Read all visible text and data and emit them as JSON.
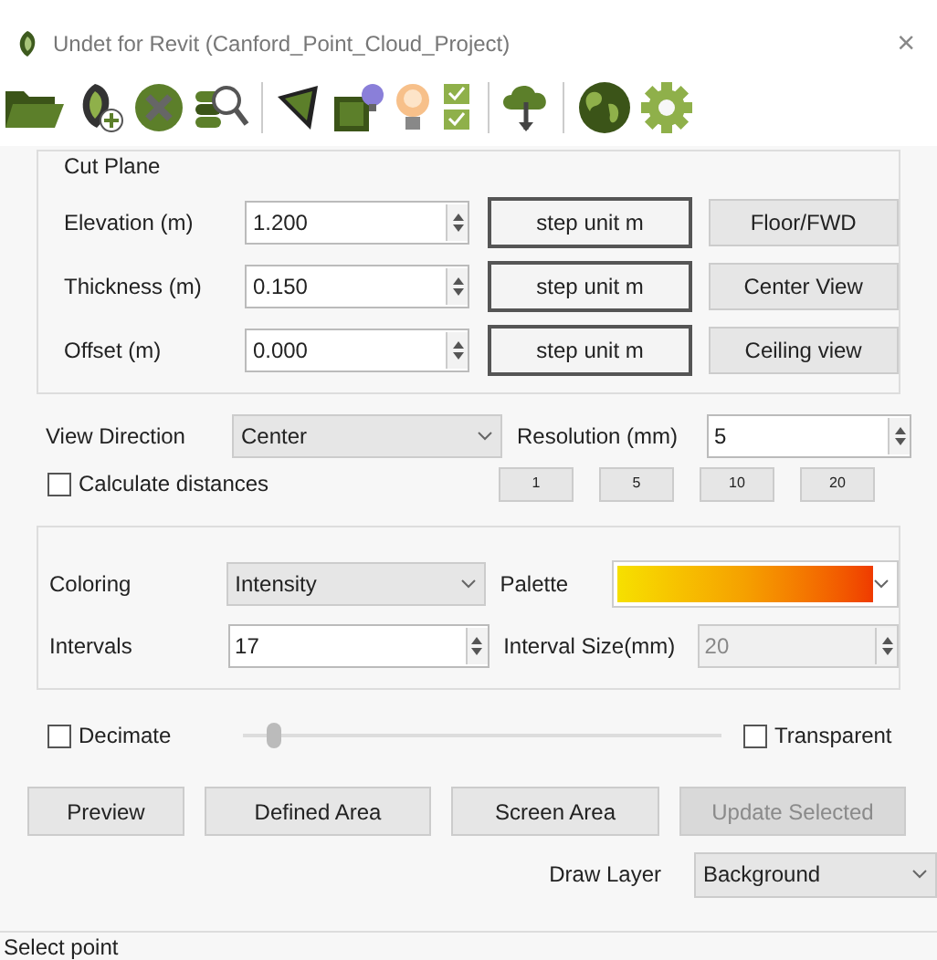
{
  "window": {
    "title": "Undet for Revit (Canford_Point_Cloud_Project)",
    "close": "×"
  },
  "cut_plane": {
    "title": "Cut Plane",
    "rows": [
      {
        "label": "Elevation (m)",
        "value": "1.200",
        "step_button": "step unit m",
        "view_button": "Floor/FWD"
      },
      {
        "label": "Thickness (m)",
        "value": "0.150",
        "step_button": "step unit m",
        "view_button": "Center View"
      },
      {
        "label": "Offset (m)",
        "value": "0.000",
        "step_button": "step unit m",
        "view_button": "Ceiling view"
      }
    ]
  },
  "view_direction": {
    "label": "View Direction",
    "value": "Center"
  },
  "resolution": {
    "label": "Resolution (mm)",
    "value": "5",
    "presets": [
      "1",
      "5",
      "10",
      "20"
    ]
  },
  "calculate_distances": {
    "label": "Calculate distances",
    "checked": false
  },
  "coloring": {
    "label": "Coloring",
    "value": "Intensity"
  },
  "palette": {
    "label": "Palette"
  },
  "intervals": {
    "label": "Intervals",
    "value": "17"
  },
  "interval_size": {
    "label": "Interval Size(mm)",
    "value": "20",
    "disabled": true
  },
  "decimate": {
    "label": "Decimate",
    "checked": false,
    "level": 0.05
  },
  "transparent": {
    "label": "Transparent",
    "checked": false
  },
  "buttons": [
    {
      "label": "Preview",
      "disabled": false
    },
    {
      "label": "Defined Area",
      "disabled": false
    },
    {
      "label": "Screen Area",
      "disabled": false
    },
    {
      "label": "Update Selected",
      "disabled": true
    }
  ],
  "draw_layer": {
    "label": "Draw Layer",
    "value": "Background"
  },
  "status_bar": {
    "text": "Select point"
  }
}
